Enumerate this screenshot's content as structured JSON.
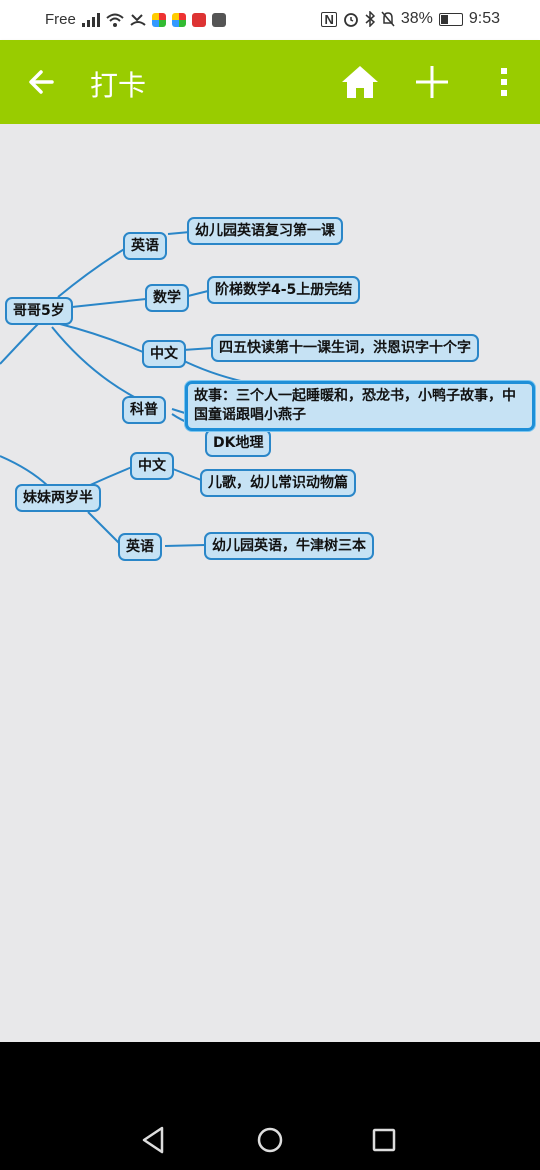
{
  "status_bar": {
    "carrier": "Free",
    "battery": "38%",
    "battery_level": 0.38,
    "time": "9:53"
  },
  "toolbar": {
    "title": "打卡",
    "back_icon": "arrow-left-icon",
    "home_icon": "home-icon",
    "add_icon": "plus-icon",
    "menu_icon": "more-vertical-icon",
    "color": "#99cc00"
  },
  "mindmap": {
    "nodes": {
      "gege": "哥哥5岁",
      "gege_english": "英语",
      "gege_english_detail": "幼儿园英语复习第一课",
      "gege_math": "数学",
      "gege_math_detail": "阶梯数学4-5上册完结",
      "gege_chinese": "中文",
      "gege_chinese_detail": "四五快读第十一课生词，洪恩识字十个字",
      "gege_science": "科普",
      "gege_science_story": "故事：三个人一起睡暖和，恐龙书，小鸭子故事，中国童谣跟唱小燕子",
      "gege_science_dk": "DK地理",
      "meimei": "妹妹两岁半",
      "meimei_chinese": "中文",
      "meimei_chinese_detail": "儿歌，幼儿常识动物篇",
      "meimei_english": "英语",
      "meimei_english_detail": "幼儿园英语，牛津树三本"
    },
    "node_fill": "#c6e2f4",
    "node_border": "#2a86c8",
    "line_color": "#2a86c8"
  }
}
